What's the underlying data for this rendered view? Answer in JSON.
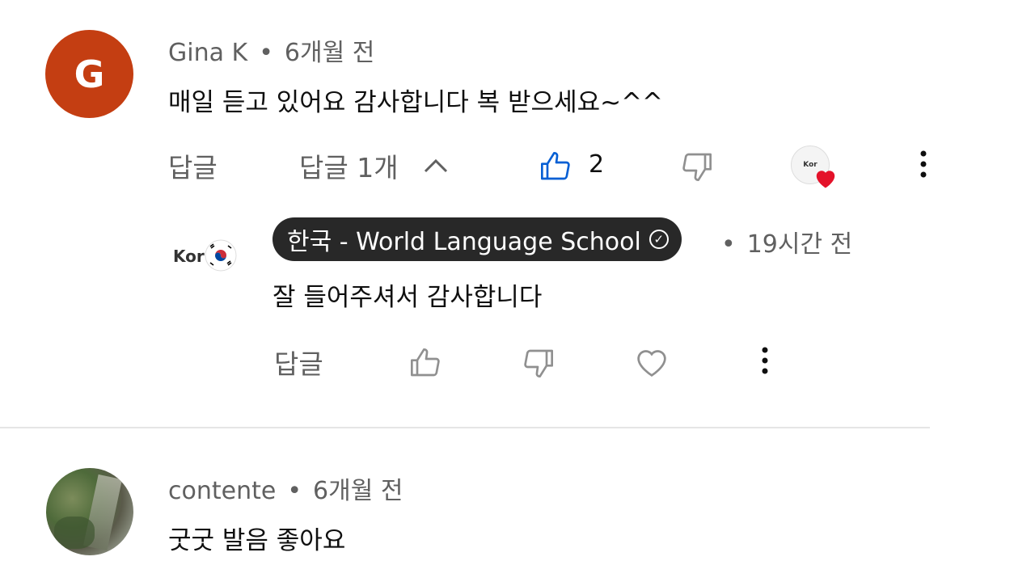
{
  "comments": [
    {
      "avatar_letter": "G",
      "author": "Gina K",
      "time": "6개월 전",
      "text": "매일 듣고 있어요 감사합니다 복 받으세요~^^",
      "reply_label": "답글",
      "replies_toggle": "답글 1개",
      "like_count": "2",
      "replies": [
        {
          "author": "한국 - World Language School",
          "time": "19시간 전",
          "text": "잘 들어주셔서 감사합니다",
          "reply_label": "답글",
          "avatar_text": "Kor"
        }
      ]
    },
    {
      "author": "contente",
      "time": "6개월 전",
      "text": "굿굿 발음 좋아요"
    }
  ],
  "colors": {
    "avatar_g": "#c43e12",
    "liked_blue": "#065fd4",
    "badge_bg": "#282828",
    "heart_red": "#e4122a"
  }
}
